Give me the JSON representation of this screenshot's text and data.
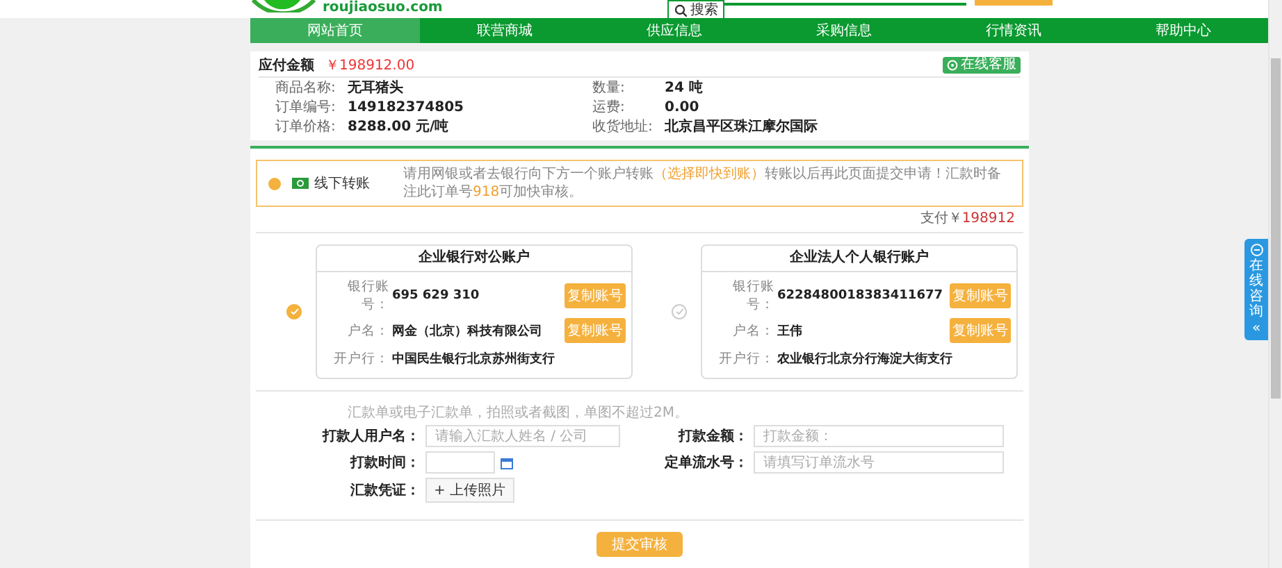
{
  "header": {
    "logo_text": "roujiaosuo.com",
    "search_tab": "搜索"
  },
  "nav": {
    "items": [
      {
        "label": "网站首页",
        "selected": true
      },
      {
        "label": "联营商城",
        "selected": false
      },
      {
        "label": "供应信息",
        "selected": false
      },
      {
        "label": "采购信息",
        "selected": false
      },
      {
        "label": "行情资讯",
        "selected": false
      },
      {
        "label": "帮助中心",
        "selected": false
      }
    ]
  },
  "order": {
    "amount_label": "应付金额",
    "amount": "￥198912.00",
    "service_button": "在线客服",
    "fields": [
      {
        "label": "商品名称:",
        "value": "无耳猪头"
      },
      {
        "label": "数量:",
        "value": "24 吨"
      },
      {
        "label": "订单编号:",
        "value": "149182374805"
      },
      {
        "label": "运费:",
        "value": "0.00"
      },
      {
        "label": "订单价格:",
        "value": "8288.00 元/吨"
      },
      {
        "label": "收货地址:",
        "value": "北京昌平区珠江摩尔国际"
      }
    ]
  },
  "payment": {
    "method": {
      "label": "线下转账",
      "selected": true
    },
    "notice": [
      {
        "text": "请用网银或者去银行向下方一个账户转账",
        "kind": "plain"
      },
      {
        "text": "（选择即快到账）",
        "kind": "highlight"
      },
      {
        "text": "转账以后再此页面提交申请！汇款时备注此订单号",
        "kind": "plain"
      },
      {
        "text": "918",
        "kind": "highlight"
      },
      {
        "text": "可加快审核。",
        "kind": "plain"
      }
    ],
    "total_label": "支付￥",
    "total": "198912",
    "accounts": [
      {
        "title": "企业银行对公账户",
        "selected": true,
        "rows": [
          {
            "label": "银行账号：",
            "value": "695 629 310",
            "copy_button": "复制账号"
          },
          {
            "label": "户名：",
            "value": "网金（北京）科技有限公司",
            "copy_button": "复制账号"
          },
          {
            "label": "开户行：",
            "value": "中国民生银行北京苏州街支行"
          }
        ]
      },
      {
        "title": "企业法人个人银行账户",
        "selected": false,
        "rows": [
          {
            "label": "银行账号：",
            "value": "6228480018383411677",
            "copy_button": "复制账号"
          },
          {
            "label": "户名：",
            "value": "王伟",
            "copy_button": "复制账号"
          },
          {
            "label": "开户行：",
            "value": "农业银行北京分行海淀大街支行"
          }
        ]
      }
    ],
    "upload_hint": "汇款单或电子汇款单，拍照或者截图，单图不超过2M。",
    "form": [
      {
        "label": "打款人用户名：",
        "kind": "text",
        "placeholder": "请输入汇款人姓名 / 公司"
      },
      {
        "label": "打款金额：",
        "kind": "text",
        "placeholder": "打款金额："
      },
      {
        "label": "打款时间：",
        "kind": "date"
      },
      {
        "label": "定单流水号：",
        "kind": "text",
        "placeholder": "请填写订单流水号"
      },
      {
        "label": "汇款凭证：",
        "kind": "upload",
        "button": "+ 上传照片"
      }
    ],
    "submit": "提交审核"
  },
  "float_tab": {
    "label": "在线咨询",
    "arrow": "«"
  }
}
